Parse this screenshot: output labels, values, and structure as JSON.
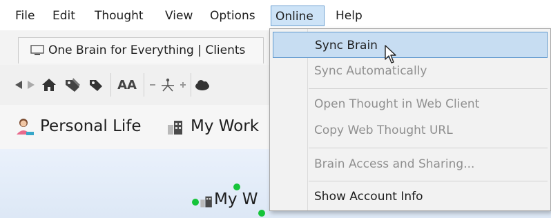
{
  "menubar": {
    "items": [
      "File",
      "Edit",
      "Thought",
      "View",
      "Options",
      "Online",
      "Help"
    ],
    "active": "Online"
  },
  "tab": {
    "label": "One Brain for Everything | Clients",
    "icon": "monitor-icon"
  },
  "toolbar": {
    "font_button": "AA",
    "icons": [
      "back-icon",
      "forward-icon",
      "home-icon",
      "tags-icon",
      "tag-icon",
      "font-size-icon",
      "zoom-out-icon",
      "layout-icon",
      "zoom-in-icon",
      "cloud-icon"
    ]
  },
  "pins": [
    {
      "label": "Personal Life",
      "icon": "person-icon"
    },
    {
      "label": "My Work",
      "icon": "office-building-icon"
    }
  ],
  "canvas": {
    "node_label": "My W"
  },
  "online_menu": {
    "items": [
      {
        "label": "Sync Brain",
        "state": "highlighted"
      },
      {
        "label": "Sync Automatically",
        "state": "disabled"
      },
      {
        "label": "Open Thought in Web Client",
        "state": "disabled"
      },
      {
        "label": "Copy Web Thought URL",
        "state": "disabled"
      },
      {
        "label": "Brain Access and Sharing...",
        "state": "disabled"
      },
      {
        "label": "Show Account Info",
        "state": "enabled"
      }
    ]
  },
  "colors": {
    "menu_highlight": "#c7ddf2",
    "menu_highlight_border": "#5f98cd",
    "disabled_text": "#8f8f8f",
    "node_dot": "#16c43a",
    "canvas_bg": "#e4edf9"
  }
}
